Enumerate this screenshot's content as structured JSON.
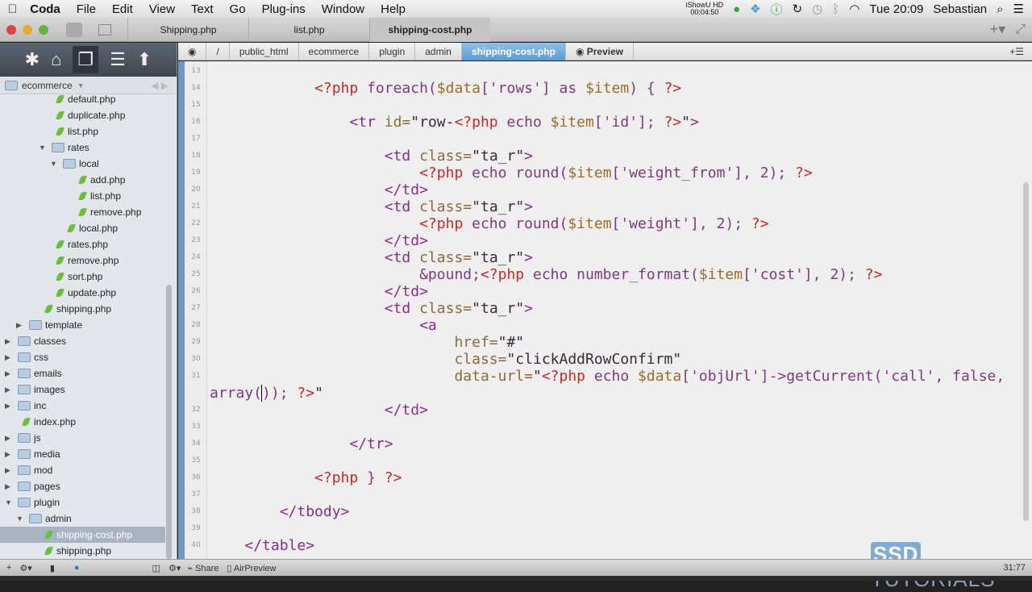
{
  "menubar": {
    "app": "Coda",
    "items": [
      "File",
      "Edit",
      "View",
      "Text",
      "Go",
      "Plug-ins",
      "Window",
      "Help"
    ],
    "recorder": "iShowU HD",
    "recorder_time": "00:04:50",
    "clock": "Tue 20:09",
    "user": "Sebastian"
  },
  "tabs": [
    {
      "label": "Shipping.php"
    },
    {
      "label": "list.php"
    },
    {
      "label": "shipping-cost.php",
      "active": true
    }
  ],
  "sidebar": {
    "site": "ecommerce",
    "tree": [
      {
        "label": "default.php",
        "depth": 3,
        "type": "file"
      },
      {
        "label": "duplicate.php",
        "depth": 3,
        "type": "file"
      },
      {
        "label": "list.php",
        "depth": 3,
        "type": "file"
      },
      {
        "label": "rates",
        "depth": 3,
        "type": "folder",
        "open": true
      },
      {
        "label": "local",
        "depth": 4,
        "type": "folder",
        "open": true
      },
      {
        "label": "add.php",
        "depth": 5,
        "type": "file"
      },
      {
        "label": "list.php",
        "depth": 5,
        "type": "file"
      },
      {
        "label": "remove.php",
        "depth": 5,
        "type": "file"
      },
      {
        "label": "local.php",
        "depth": 4,
        "type": "file"
      },
      {
        "label": "rates.php",
        "depth": 3,
        "type": "file"
      },
      {
        "label": "remove.php",
        "depth": 3,
        "type": "file"
      },
      {
        "label": "sort.php",
        "depth": 3,
        "type": "file"
      },
      {
        "label": "update.php",
        "depth": 3,
        "type": "file"
      },
      {
        "label": "shipping.php",
        "depth": 2,
        "type": "file"
      },
      {
        "label": "template",
        "depth": 1,
        "type": "folder"
      },
      {
        "label": "classes",
        "depth": 0,
        "type": "folder"
      },
      {
        "label": "css",
        "depth": 0,
        "type": "folder"
      },
      {
        "label": "emails",
        "depth": 0,
        "type": "folder"
      },
      {
        "label": "images",
        "depth": 0,
        "type": "folder"
      },
      {
        "label": "inc",
        "depth": 0,
        "type": "folder"
      },
      {
        "label": "index.php",
        "depth": 0,
        "type": "file"
      },
      {
        "label": "js",
        "depth": 0,
        "type": "folder"
      },
      {
        "label": "media",
        "depth": 0,
        "type": "folder"
      },
      {
        "label": "mod",
        "depth": 0,
        "type": "folder"
      },
      {
        "label": "pages",
        "depth": 0,
        "type": "folder"
      },
      {
        "label": "plugin",
        "depth": 0,
        "type": "folder",
        "open": true
      },
      {
        "label": "admin",
        "depth": 1,
        "type": "folder",
        "open": true
      },
      {
        "label": "shipping-cost.php",
        "depth": 2,
        "type": "file",
        "selected": true
      },
      {
        "label": "shipping.php",
        "depth": 2,
        "type": "file"
      }
    ]
  },
  "breadcrumb": [
    "/",
    "public_html",
    "ecommerce",
    "plugin",
    "admin",
    "shipping-cost.php"
  ],
  "preview_label": "Preview",
  "code": [
    {
      "n": "13",
      "t": []
    },
    {
      "n": "14",
      "t": [
        [
          "n",
          "            "
        ],
        [
          "p",
          "<?php "
        ],
        [
          "k",
          "foreach("
        ],
        [
          "v",
          "$data"
        ],
        [
          "k",
          "['rows'] as "
        ],
        [
          "v",
          "$item"
        ],
        [
          "k",
          ") { "
        ],
        [
          "p",
          "?>"
        ]
      ]
    },
    {
      "n": "15",
      "t": []
    },
    {
      "n": "16",
      "t": [
        [
          "n",
          "                "
        ],
        [
          "t",
          "<tr "
        ],
        [
          "a",
          "id="
        ],
        [
          "s",
          "\"row-"
        ],
        [
          "p",
          "<?php "
        ],
        [
          "k",
          "echo "
        ],
        [
          "v",
          "$item"
        ],
        [
          "k",
          "['id']; "
        ],
        [
          "p",
          "?>"
        ],
        [
          "s",
          "\""
        ],
        [
          "t",
          ">"
        ]
      ]
    },
    {
      "n": "17",
      "t": []
    },
    {
      "n": "18",
      "t": [
        [
          "n",
          "                    "
        ],
        [
          "t",
          "<td "
        ],
        [
          "a",
          "class="
        ],
        [
          "s",
          "\"ta_r\""
        ],
        [
          "t",
          ">"
        ]
      ]
    },
    {
      "n": "19",
      "t": [
        [
          "n",
          "                        "
        ],
        [
          "p",
          "<?php "
        ],
        [
          "k",
          "echo round("
        ],
        [
          "v",
          "$item"
        ],
        [
          "k",
          "['weight_from'], 2); "
        ],
        [
          "p",
          "?>"
        ]
      ]
    },
    {
      "n": "20",
      "t": [
        [
          "n",
          "                    "
        ],
        [
          "t",
          "</td>"
        ]
      ]
    },
    {
      "n": "21",
      "t": [
        [
          "n",
          "                    "
        ],
        [
          "t",
          "<td "
        ],
        [
          "a",
          "class="
        ],
        [
          "s",
          "\"ta_r\""
        ],
        [
          "t",
          ">"
        ]
      ]
    },
    {
      "n": "22",
      "t": [
        [
          "n",
          "                        "
        ],
        [
          "p",
          "<?php "
        ],
        [
          "k",
          "echo round("
        ],
        [
          "v",
          "$item"
        ],
        [
          "k",
          "['weight'], 2); "
        ],
        [
          "p",
          "?>"
        ]
      ]
    },
    {
      "n": "23",
      "t": [
        [
          "n",
          "                    "
        ],
        [
          "t",
          "</td>"
        ]
      ]
    },
    {
      "n": "24",
      "t": [
        [
          "n",
          "                    "
        ],
        [
          "t",
          "<td "
        ],
        [
          "a",
          "class="
        ],
        [
          "s",
          "\"ta_r\""
        ],
        [
          "t",
          ">"
        ]
      ]
    },
    {
      "n": "25",
      "t": [
        [
          "n",
          "                        "
        ],
        [
          "k",
          "&pound;"
        ],
        [
          "p",
          "<?php "
        ],
        [
          "k",
          "echo number_format("
        ],
        [
          "v",
          "$item"
        ],
        [
          "k",
          "['cost'], 2); "
        ],
        [
          "p",
          "?>"
        ]
      ]
    },
    {
      "n": "26",
      "t": [
        [
          "n",
          "                    "
        ],
        [
          "t",
          "</td>"
        ]
      ]
    },
    {
      "n": "27",
      "t": [
        [
          "n",
          "                    "
        ],
        [
          "t",
          "<td "
        ],
        [
          "a",
          "class="
        ],
        [
          "s",
          "\"ta_r\""
        ],
        [
          "t",
          ">"
        ]
      ]
    },
    {
      "n": "28",
      "t": [
        [
          "n",
          "                        "
        ],
        [
          "t",
          "<a"
        ]
      ]
    },
    {
      "n": "29",
      "t": [
        [
          "n",
          "                            "
        ],
        [
          "a",
          "href="
        ],
        [
          "s",
          "\"#\""
        ]
      ]
    },
    {
      "n": "30",
      "t": [
        [
          "n",
          "                            "
        ],
        [
          "a",
          "class="
        ],
        [
          "s",
          "\"clickAddRowConfirm\""
        ]
      ]
    },
    {
      "n": "31",
      "t": [
        [
          "n",
          "                            "
        ],
        [
          "a",
          "data-url="
        ],
        [
          "s",
          "\""
        ],
        [
          "p",
          "<?php "
        ],
        [
          "k",
          "echo "
        ],
        [
          "v",
          "$data"
        ],
        [
          "k",
          "['objUrl']->getCurrent('call', false,"
        ]
      ]
    },
    {
      "n": "",
      "t": [
        [
          "k",
          "array("
        ],
        [
          "caret",
          ""
        ],
        [
          "k",
          "));"
        ],
        [
          "n",
          " "
        ],
        [
          "p",
          "?>"
        ],
        [
          "s",
          "\""
        ]
      ]
    },
    {
      "n": "32",
      "t": [
        [
          "n",
          "                    "
        ],
        [
          "t",
          "</td>"
        ]
      ]
    },
    {
      "n": "33",
      "t": []
    },
    {
      "n": "34",
      "t": [
        [
          "n",
          "                "
        ],
        [
          "t",
          "</tr>"
        ]
      ]
    },
    {
      "n": "35",
      "t": []
    },
    {
      "n": "36",
      "t": [
        [
          "n",
          "            "
        ],
        [
          "p",
          "<?php "
        ],
        [
          "k",
          "} "
        ],
        [
          "p",
          "?>"
        ]
      ]
    },
    {
      "n": "37",
      "t": []
    },
    {
      "n": "38",
      "t": [
        [
          "n",
          "        "
        ],
        [
          "t",
          "</tbody>"
        ]
      ]
    },
    {
      "n": "39",
      "t": []
    },
    {
      "n": "40",
      "t": [
        [
          "n",
          "    "
        ],
        [
          "t",
          "</table>"
        ]
      ]
    }
  ],
  "status": {
    "share": "Share",
    "airpreview": "AirPreview",
    "position": "31:77"
  },
  "watermark": "SSD TUTORIALS"
}
